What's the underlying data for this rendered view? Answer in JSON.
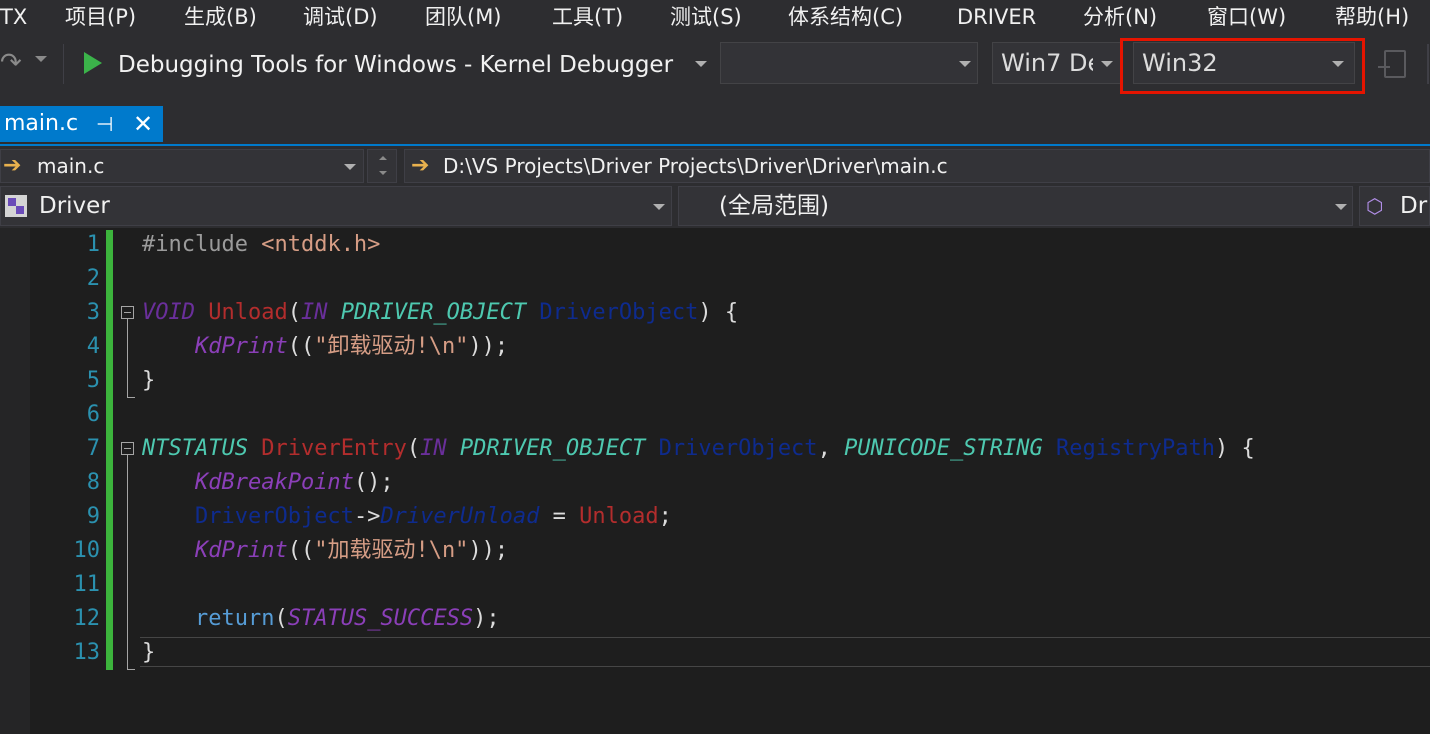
{
  "menu": [
    "TX",
    "项目(P)",
    "生成(B)",
    "调试(D)",
    "团队(M)",
    "工具(T)",
    "测试(S)",
    "体系结构(C)",
    "DRIVER",
    "分析(N)",
    "窗口(W)",
    "帮助(H)"
  ],
  "toolbar": {
    "debugger_label": "Debugging Tools for Windows - Kernel Debugger",
    "target_combo_value": "",
    "config_value": "Win7 De",
    "platform_value": "Win32"
  },
  "tabs": [
    {
      "label": "main.c",
      "pin": "⊣",
      "close": "✕"
    }
  ],
  "nav": {
    "file_value": "main.c",
    "path_value": "D:\\VS Projects\\Driver Projects\\Driver\\Driver\\main.c"
  },
  "scope": {
    "project_value": "Driver",
    "scope_value": "(全局范围)",
    "member_value": "Dri"
  },
  "code": {
    "line_numbers": [
      "1",
      "2",
      "3",
      "4",
      "5",
      "6",
      "7",
      "8",
      "9",
      "10",
      "11",
      "12",
      "13"
    ],
    "l1_pre": "#include ",
    "l1_inc": "<ntddk.h>",
    "void_kw": "VOID",
    "unload_fn": "Unload",
    "in_kw": "IN",
    "pdo_type": "PDRIVER_OBJECT",
    "do_param": "DriverObject",
    "kdprint": "KdPrint",
    "str_unload": "\"卸载驱动!\\n\"",
    "ntstatus_type": "NTSTATUS",
    "entry_fn": "DriverEntry",
    "puni_type": "PUNICODE_STRING",
    "regpath_param": "RegistryPath",
    "kdbreak": "KdBreakPoint",
    "driverunload_member": "DriverUnload",
    "str_load": "\"加载驱动!\\n\"",
    "return_kw": "return",
    "status_success": "STATUS_SUCCESS"
  },
  "colors": {
    "accent": "#007acc",
    "highlight_border": "#e51400",
    "change_bar": "#3cb43c"
  }
}
